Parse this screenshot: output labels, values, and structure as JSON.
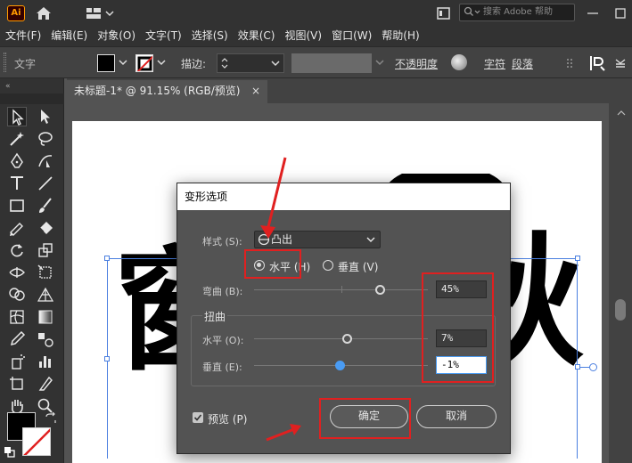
{
  "app": {
    "logo_text": "Ai",
    "search_placeholder": "搜索 Adobe 帮助"
  },
  "menu": [
    "文件(F)",
    "编辑(E)",
    "对象(O)",
    "文字(T)",
    "选择(S)",
    "效果(C)",
    "视图(V)",
    "窗口(W)",
    "帮助(H)"
  ],
  "control_bar": {
    "object_type": "文字",
    "stroke_label": "描边:",
    "opacity_label": "不透明度",
    "char_label": "字符",
    "para_label": "段落"
  },
  "document_tab": {
    "title": "未标题-1* @ 91.15% (RGB/预览)",
    "close": "×"
  },
  "artwork": {
    "left_glyph": "窗",
    "right_glyph": "秋"
  },
  "dialog": {
    "title": "变形选项",
    "style_label": "样式 (S):",
    "style_value": "凸出",
    "horizontal_label": "水平 (H)",
    "vertical_label": "垂直 (V)",
    "bend_label": "弯曲 (B):",
    "bend_value": "45%",
    "bend_fraction": 0.725,
    "distortion_heading": "扭曲",
    "distort_h_label": "水平 (O):",
    "distort_h_value": "7%",
    "distort_h_fraction": 0.535,
    "distort_v_label": "垂直 (E):",
    "distort_v_value": "-1%",
    "distort_v_fraction": 0.495,
    "preview_label": "预览 (P)",
    "ok_label": "确定",
    "cancel_label": "取消"
  },
  "colors": {
    "accent": "#4a9cf4",
    "highlight_red": "#e02020",
    "brand_orange": "#ff9a00"
  }
}
